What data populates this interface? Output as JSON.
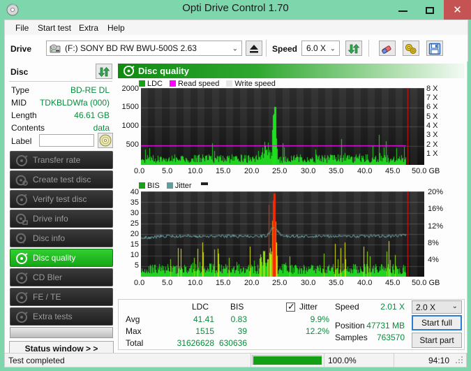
{
  "window": {
    "title": "Opti Drive Control 1.70",
    "icon": "disc-icon",
    "minimize": "–",
    "maximize": "□",
    "close": "✕",
    "titlebar_color": "#7ed6ad",
    "close_color": "#c65353"
  },
  "menu": [
    {
      "label": "File"
    },
    {
      "label": "Start test"
    },
    {
      "label": "Extra"
    },
    {
      "label": "Help"
    }
  ],
  "toolbar": {
    "drive_label": "Drive",
    "drive_value": "(F:)  SONY BD RW BWU-500S 2.63",
    "drive_icon": "drive-icon",
    "eject_icon": "eject-icon",
    "speed_label": "Speed",
    "speed_value": "6.0 X",
    "refresh_icon": "refresh-icon",
    "erase_icon": "eraser-icon",
    "settings_icon": "gears-icon",
    "save_icon": "save-icon",
    "dropdown_arrow": "⌄"
  },
  "disc": {
    "header": "Disc",
    "refresh_icon": "refresh-icon",
    "rows": [
      {
        "key": "Type",
        "value": "BD-RE DL"
      },
      {
        "key": "MID",
        "value": "TDKBLDWfa (000)"
      },
      {
        "key": "Length",
        "value": "46.61 GB"
      },
      {
        "key": "Contents",
        "value": "data"
      }
    ],
    "label_key": "Label",
    "label_value": "",
    "label_placeholder": "",
    "cd_icon": "cd-icon"
  },
  "sidebar": {
    "items": [
      {
        "label": "Transfer rate",
        "icon": "disc-test-icon",
        "active": false
      },
      {
        "label": "Create test disc",
        "icon": "disc-create-icon",
        "active": false
      },
      {
        "label": "Verify test disc",
        "icon": "disc-verify-icon",
        "active": false
      },
      {
        "label": "Drive info",
        "icon": "drive-info-icon",
        "active": false
      },
      {
        "label": "Disc info",
        "icon": "disc-info-icon",
        "active": false
      },
      {
        "label": "Disc quality",
        "icon": "disc-quality-icon",
        "active": true
      },
      {
        "label": "CD Bler",
        "icon": "disc-bler-icon",
        "active": false
      },
      {
        "label": "FE / TE",
        "icon": "disc-fete-icon",
        "active": false
      },
      {
        "label": "Extra tests",
        "icon": "disc-extra-icon",
        "active": false
      }
    ],
    "status_window_button": "Status window > >"
  },
  "main": {
    "header": "Disc quality",
    "header_icon": "disc-quality-icon"
  },
  "chart_data": [
    {
      "id": "top-chart",
      "type": "area",
      "title": "",
      "xlabel": "50.0 GB",
      "ylabel": "",
      "legend": [
        {
          "label": "LDC",
          "color": "#18a018"
        },
        {
          "label": "Read speed",
          "color": "#ff00ff"
        },
        {
          "label": "Write speed",
          "color": "#e6e6e6"
        }
      ],
      "legend_position": "top-left",
      "grid": true,
      "xlim": [
        0,
        50
      ],
      "xticks": [
        0.0,
        5.0,
        10.0,
        15.0,
        20.0,
        25.0,
        30.0,
        35.0,
        40.0,
        45.0,
        50.0
      ],
      "xticklabels": [
        "0.0",
        "5.0",
        "10.0",
        "15.0",
        "20.0",
        "25.0",
        "30.0",
        "35.0",
        "40.0",
        "45.0",
        "50.0 GB"
      ],
      "ylim": [
        0,
        2000
      ],
      "yticks": [
        500,
        1000,
        1500,
        2000
      ],
      "yticklabels": [
        "500",
        "1000",
        "1500",
        "2000"
      ],
      "y2lim": [
        0,
        8
      ],
      "y2ticks": [
        1,
        2,
        3,
        4,
        5,
        6,
        7,
        8
      ],
      "y2ticklabels": [
        "1 X",
        "2 X",
        "3 X",
        "4 X",
        "5 X",
        "6 X",
        "7 X",
        "8 X"
      ],
      "series": [
        {
          "name": "LDC",
          "color": "#18d018",
          "kind": "bars",
          "avg": 41.41,
          "max": 1515,
          "peak_x": 23.5,
          "end_x": 46.8,
          "baseline": 230
        },
        {
          "name": "Read speed",
          "color": "#ff00ff",
          "kind": "line",
          "value_x": 2.0,
          "end_x": 46.8
        },
        {
          "name": "Scan end marker",
          "color": "#ff0000",
          "kind": "vline",
          "x": 47.0
        }
      ]
    },
    {
      "id": "bottom-chart",
      "type": "area",
      "title": "",
      "xlabel": "50.0 GB",
      "ylabel": "",
      "legend": [
        {
          "label": "BIS",
          "color": "#18a018"
        },
        {
          "label": "Jitter",
          "color": "#5f9ea0"
        }
      ],
      "legend_position": "top-left",
      "grid": true,
      "xlim": [
        0,
        50
      ],
      "xticks": [
        0.0,
        5.0,
        10.0,
        15.0,
        20.0,
        25.0,
        30.0,
        35.0,
        40.0,
        45.0,
        50.0
      ],
      "xticklabels": [
        "0.0",
        "5.0",
        "10.0",
        "15.0",
        "20.0",
        "25.0",
        "30.0",
        "35.0",
        "40.0",
        "45.0",
        "50.0 GB"
      ],
      "ylim": [
        0,
        40
      ],
      "yticks": [
        5,
        10,
        15,
        20,
        25,
        30,
        35,
        40
      ],
      "yticklabels": [
        "5",
        "10",
        "15",
        "20",
        "25",
        "30",
        "35",
        "40"
      ],
      "y2lim": [
        0,
        20
      ],
      "y2ticks": [
        4,
        8,
        12,
        16,
        20
      ],
      "y2ticklabels": [
        "4%",
        "8%",
        "12%",
        "16%",
        "20%"
      ],
      "series": [
        {
          "name": "BIS",
          "color": "#18d018",
          "kind": "bars",
          "avg": 0.83,
          "max": 39,
          "peak_x": 23.5,
          "end_x": 46.8,
          "baseline": 5
        },
        {
          "name": "Jitter",
          "color": "#6fa8ac",
          "kind": "line",
          "avg": 9.9,
          "max": 12.2,
          "end_x": 46.8,
          "level": 19
        },
        {
          "name": "Scan end marker",
          "color": "#ff0000",
          "kind": "vline",
          "x": 47.0
        }
      ]
    }
  ],
  "stats": {
    "columns": [
      "LDC",
      "BIS"
    ],
    "rows": [
      {
        "label": "Avg",
        "ldc": "41.41",
        "bis": "0.83",
        "jitter": "9.9%"
      },
      {
        "label": "Max",
        "ldc": "1515",
        "bis": "39",
        "jitter": "12.2%"
      },
      {
        "label": "Total",
        "ldc": "31626628",
        "bis": "630636",
        "jitter": ""
      }
    ],
    "jitter_label": "Jitter",
    "jitter_checked": true
  },
  "readout": {
    "speed_label": "Speed",
    "speed_value": "2.01 X",
    "position_label": "Position",
    "position_value": "47731 MB",
    "samples_label": "Samples",
    "samples_value": "763570",
    "speed_select": "2.0 X",
    "speed_select_arrow": "⌄",
    "start_full": "Start full",
    "start_part": "Start part"
  },
  "statusbar": {
    "message": "Test completed",
    "progress_text": "100.0%",
    "progress_value": 100,
    "elapsed": "94:10"
  }
}
